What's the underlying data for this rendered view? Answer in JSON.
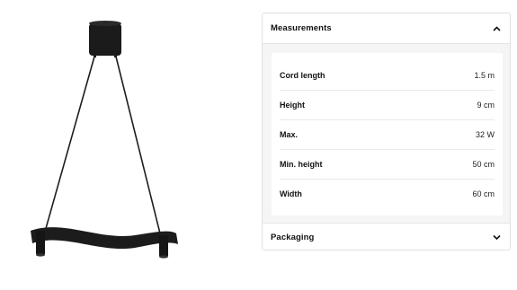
{
  "measurements": {
    "title": "Measurements",
    "expanded": true,
    "rows": [
      {
        "label": "Cord length",
        "value": "1.5 m"
      },
      {
        "label": "Height",
        "value": "9 cm"
      },
      {
        "label": "Max.",
        "value": "32 W"
      },
      {
        "label": "Min. height",
        "value": "50 cm"
      },
      {
        "label": "Width",
        "value": "60 cm"
      }
    ]
  },
  "packaging": {
    "title": "Packaging",
    "expanded": false
  },
  "icons": {
    "collapse": "chevron-up-icon",
    "expand": "chevron-down-icon"
  },
  "colors": {
    "panel_bg": "#f5f5f5",
    "text": "#111111",
    "lamp": "#1b1b1b"
  }
}
